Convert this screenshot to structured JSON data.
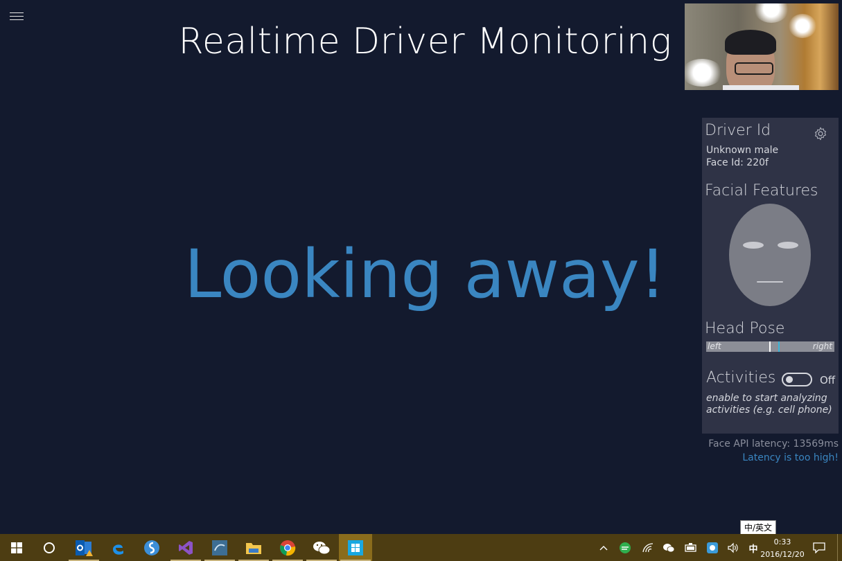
{
  "app": {
    "title": "Realtime Driver Monitoring",
    "alert": "Looking away!"
  },
  "panel": {
    "driver_heading": "Driver Id",
    "driver_name": "Unknown male",
    "face_id": "Face Id: 220f",
    "facial_heading": "Facial Features",
    "head_pose_heading": "Head Pose",
    "head_pose_left": "left",
    "head_pose_right": "right",
    "activities_heading": "Activities",
    "activities_toggle_state": "Off",
    "activities_hint_line1": "enable to start analyzing",
    "activities_hint_line2": "activities (e.g. cell phone)"
  },
  "status": {
    "latency": "Face API latency: 13569ms",
    "latency_warning": "Latency is too high!"
  },
  "taskbar": {
    "apps": [
      "windows-start",
      "cortana",
      "outlook",
      "edge",
      "simplenote",
      "visual-studio",
      "mysql-workbench",
      "file-explorer",
      "chrome",
      "wechat",
      "driver-monitoring-app"
    ],
    "ime_tooltip": "中/英文",
    "ime": "中",
    "time": "0:33",
    "date": "2016/12/20"
  },
  "colors": {
    "background": "#131a2e",
    "accent": "#3a86c1",
    "panel": "#2f3346",
    "taskbar": "#4d3d12"
  }
}
